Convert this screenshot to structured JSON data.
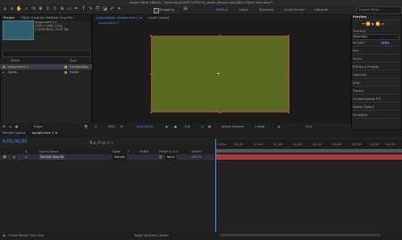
{
  "window": {
    "title": "Adobe After Effects - /Volumes/AGIMETLIFE/Feb_week_files/scripts/After Effect intro.aep *"
  },
  "toolbar": {
    "snapping_label": "Snapping",
    "workspaces": [
      "Default",
      "Learn",
      "Standard",
      "Small Screen",
      "Libraries"
    ],
    "search_placeholder": "Search Help"
  },
  "project_panel": {
    "tabs": [
      "Project",
      "Effect Controls Medium Gray-Yel"
    ],
    "item_name": "assignment 1 ▾",
    "item_info1": "1920 x 1080 (1.00)",
    "item_info2": "Δ 0;00;06;00, 29.97 fps",
    "columns": {
      "name": "Name",
      "type": "Type"
    },
    "rows": [
      {
        "name": "assignment 1",
        "type": "Composition",
        "selected": true
      },
      {
        "name": "Solids",
        "type": "Folder",
        "selected": false
      }
    ],
    "footer_label": "8 bpc"
  },
  "composition_panel": {
    "tabs": [
      "Composition assignment 1 ≡",
      "Layer (none)"
    ],
    "comp_label": "assignment 1",
    "canvas_color": "#5a6b1f",
    "zoom": "50%",
    "timecode": "0;00;00;00",
    "resolution": "Full",
    "camera": "Active Camera",
    "view": "1 View",
    "offset": "+0.0"
  },
  "right_panel": {
    "preview_label": "Preview",
    "shortcut_label": "Shortcut",
    "shortcut_value": "Spacebar",
    "items": [
      "Include:",
      "Info",
      "Audio",
      "Effects & Presets",
      "Libraries",
      "Align",
      "Tracker",
      "Content-Aware Fill",
      "Motion Sketch",
      "Smoother"
    ]
  },
  "timeline": {
    "tabs": [
      "Render Queue",
      "assignment 1 ≡"
    ],
    "timecode": "0;00;00;00",
    "columns": [
      "#",
      "Source Name",
      "Mode",
      "T",
      "TrkMat",
      "Parent & Link",
      "Stretch"
    ],
    "layer": {
      "index": "1",
      "name": "Medium Gray-Yel",
      "mode": "Normal",
      "parent": "None",
      "stretch": "100.0%"
    },
    "ruler_ticks": [
      "0;00s",
      "00;15f",
      "01;00f",
      "01;15f",
      "02;00f",
      "02;15f",
      "03;00f",
      "03;15f",
      "04;00f",
      "04;15f"
    ],
    "footer_left": "Frame Render Time 0ms",
    "footer_right": "Toggle Switches / Modes"
  },
  "colors": {
    "accent": "#4a8cff",
    "layer_bar": "#a83c3c",
    "canvas": "#5a6b1f"
  }
}
